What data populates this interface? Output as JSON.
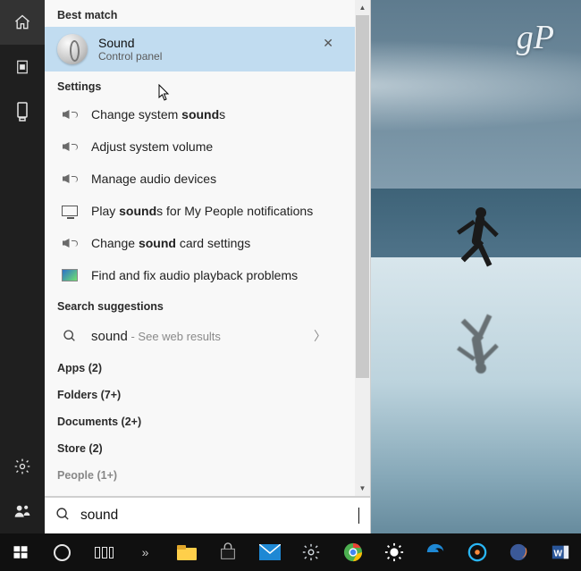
{
  "watermark": "gP",
  "headers": {
    "best_match": "Best match",
    "settings": "Settings",
    "suggestions": "Search suggestions"
  },
  "best_match": {
    "title": "Sound",
    "subtitle": "Control panel"
  },
  "settings_items": [
    {
      "pre": "Change system ",
      "bold": "sound",
      "post": "s"
    },
    {
      "pre": "Adjust system volume",
      "bold": "",
      "post": ""
    },
    {
      "pre": "Manage audio devices",
      "bold": "",
      "post": ""
    },
    {
      "pre": "Play ",
      "bold": "sound",
      "post": "s for My People notifications"
    },
    {
      "pre": "Change ",
      "bold": "sound",
      "post": " card settings"
    },
    {
      "pre": "Find and fix audio playback problems",
      "bold": "",
      "post": ""
    }
  ],
  "web_suggestion": {
    "term": "sound",
    "tail": " - See web results"
  },
  "categories": [
    "Apps (2)",
    "Folders (7+)",
    "Documents (2+)",
    "Store (2)",
    "People (1+)"
  ],
  "search": {
    "value": "sound"
  },
  "taskbar_overflow": "»"
}
